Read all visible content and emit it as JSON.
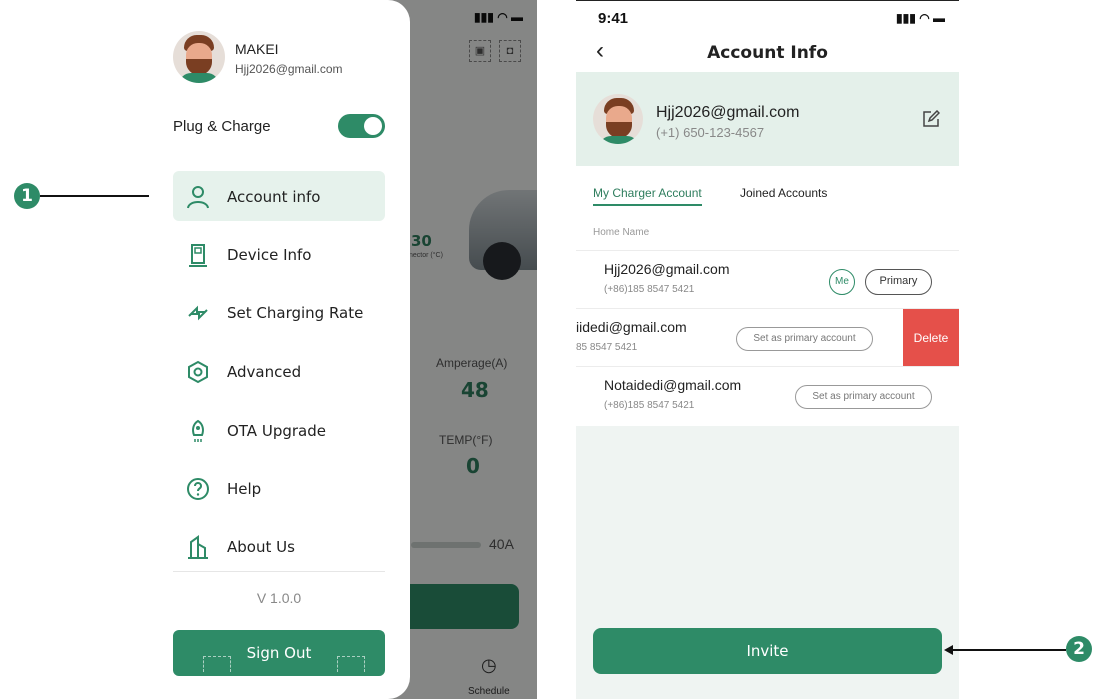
{
  "callouts": [
    {
      "number": "1"
    },
    {
      "number": "2"
    }
  ],
  "colors": {
    "accent": "#2e8b67",
    "accent_light": "#e6f2ec",
    "delete": "#e5504a"
  },
  "left_screen": {
    "background": {
      "amperage_label": "Amperage(A)",
      "amperage_value": "48",
      "temp_label": "TEMP(°F)",
      "temp_value": "0",
      "current_label": "40A",
      "connector_value": "30",
      "connector_label": "nector (°C)",
      "schedule_label": "Schedule"
    },
    "drawer": {
      "user_name": "MAKEI",
      "user_email": "Hjj2026@gmail.com",
      "plug_charge_label": "Plug & Charge",
      "plug_charge_on": true,
      "menu": [
        {
          "label": "Account info",
          "icon": "person-icon",
          "active": true
        },
        {
          "label": "Device Info",
          "icon": "charger-icon",
          "active": false
        },
        {
          "label": "Set Charging Rate",
          "icon": "swap-arrows-icon",
          "active": false
        },
        {
          "label": "Advanced",
          "icon": "hexagon-gear-icon",
          "active": false
        },
        {
          "label": "OTA Upgrade",
          "icon": "rocket-icon",
          "active": false
        },
        {
          "label": "Help",
          "icon": "question-circle-icon",
          "active": false
        },
        {
          "label": "About Us",
          "icon": "building-icon",
          "active": false
        }
      ],
      "version": "V 1.0.0",
      "sign_out": "Sign Out"
    }
  },
  "right_screen": {
    "time": "9:41",
    "title": "Account Info",
    "profile": {
      "email": "Hjj2026@gmail.com",
      "phone": "(+1)  650-123-4567"
    },
    "tabs": [
      {
        "label": "My Charger Account",
        "active": true
      },
      {
        "label": "Joined Accounts",
        "active": false
      }
    ],
    "list_header": "Home Name",
    "accounts": [
      {
        "email": "Hjj2026@gmail.com",
        "phone": "(+86)185 8547 5421",
        "me_badge": "Me",
        "primary_badge": "Primary"
      },
      {
        "email": "iidedi@gmail.com",
        "phone": "85 8547 5421",
        "action": "Set as primary account",
        "delete": "Delete"
      },
      {
        "email": "Notaidedi@gmail.com",
        "phone": "(+86)185 8547 5421",
        "action": "Set as primary account"
      }
    ],
    "invite": "Invite"
  }
}
